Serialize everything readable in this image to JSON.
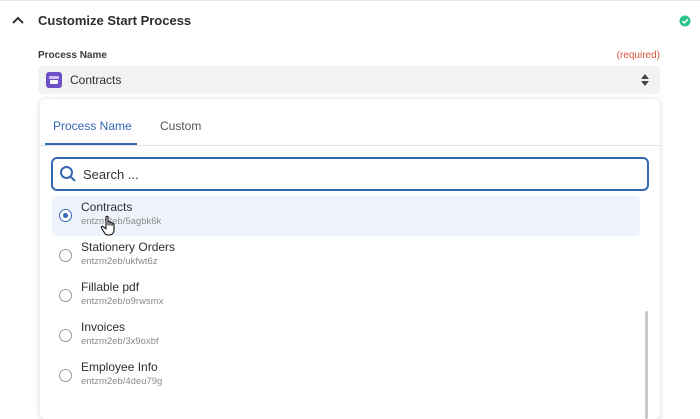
{
  "section": {
    "title": "Customize Start Process"
  },
  "field": {
    "label": "Process Name",
    "required": "(required)",
    "selected_value": "Contracts"
  },
  "dropdown": {
    "tabs": [
      {
        "label": "Process Name",
        "active": true
      },
      {
        "label": "Custom",
        "active": false
      }
    ],
    "search": {
      "placeholder": "Search ...",
      "value": ""
    },
    "items": [
      {
        "name": "Contracts",
        "id": "entzm2eb/5agbk6k",
        "selected": true
      },
      {
        "name": "Stationery Orders",
        "id": "entzm2eb/ukfwt6z",
        "selected": false
      },
      {
        "name": "Fillable pdf",
        "id": "entzm2eb/o9rwsmx",
        "selected": false
      },
      {
        "name": "Invoices",
        "id": "entzm2eb/3x9oxbf",
        "selected": false
      },
      {
        "name": "Employee Info",
        "id": "entzm2eb/4deu79g",
        "selected": false
      }
    ]
  },
  "colors": {
    "accent": "#3567b5",
    "required": "#d8553a",
    "status_ok": "#2cc38a",
    "app_icon": "#6e4fc6"
  },
  "icons": {
    "collapse": "chevron-up-icon",
    "status": "check-circle-icon",
    "app": "app-tile-icon",
    "select": "up-down-arrows-icon",
    "search": "search-icon"
  }
}
